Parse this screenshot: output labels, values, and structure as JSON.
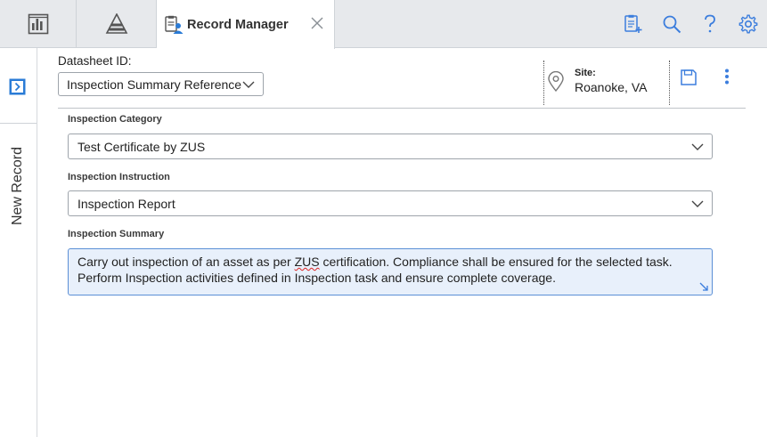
{
  "tabs": {
    "active_label": "Record Manager"
  },
  "sidebar": {
    "label": "New Record"
  },
  "header": {
    "datasheet_label": "Datasheet ID:",
    "datasheet_value": "Inspection Summary Reference",
    "site_label": "Site:",
    "site_value": "Roanoke, VA"
  },
  "fields": {
    "category": {
      "label": "Inspection Category",
      "value": "Test Certificate by ZUS"
    },
    "instruction": {
      "label": "Inspection Instruction",
      "value": "Inspection Report"
    },
    "summary": {
      "label": "Inspection Summary",
      "text_before": "Carry out inspection of an asset as per ",
      "text_flagged": "ZUS",
      "text_after": " certification. Compliance shall be ensured for the selected task. Perform Inspection activities defined in Inspection task and ensure complete coverage."
    }
  },
  "colors": {
    "accent": "#3b7ddd",
    "tabbar": "#e7e9ec",
    "textarea_bg": "#e8f0fb"
  }
}
